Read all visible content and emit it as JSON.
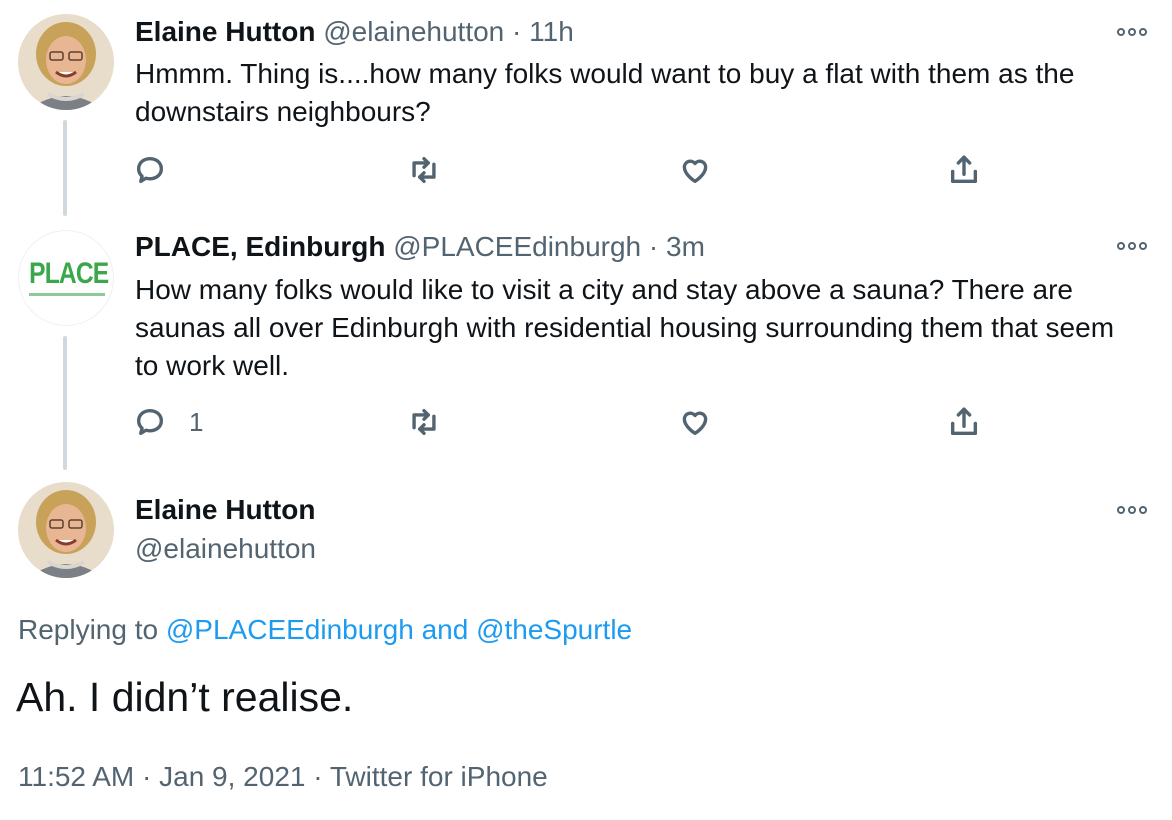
{
  "tweets": [
    {
      "author_name": "Elaine Hutton",
      "handle": "@elainehutton",
      "separator": "·",
      "time": "11h",
      "text": "Hmmm. Thing is....how many folks would want to buy a flat with them as the downstairs neighbours?",
      "reply_count": ""
    },
    {
      "author_name": "PLACE, Edinburgh",
      "handle": "@PLACEEdinburgh",
      "separator": "·",
      "time": "3m",
      "text": "How many folks would like to visit a city and stay above a sauna? There are saunas all over Edinburgh with residential housing surrounding them that seem to work well.",
      "reply_count": "1",
      "avatar_logo_text": "PLACE"
    }
  ],
  "main_tweet": {
    "author_name": "Elaine Hutton",
    "handle": "@elainehutton",
    "replying_prefix": "Replying to",
    "replying_to_1": "@PLACEEdinburgh",
    "replying_and": "and",
    "replying_to_2": "@theSpurtle",
    "text": "Ah. I didn’t realise.",
    "time": "11:52 AM",
    "separator": "·",
    "date": "Jan 9, 2021",
    "source": "Twitter for iPhone"
  },
  "icons": [
    "reply-icon",
    "retweet-icon",
    "like-icon",
    "share-icon",
    "more-icon"
  ],
  "colors": {
    "text": "#0f1419",
    "muted": "#536471",
    "link": "#1d9bf0",
    "place_green": "#3aa84a",
    "thread_line": "#cfd9de"
  }
}
